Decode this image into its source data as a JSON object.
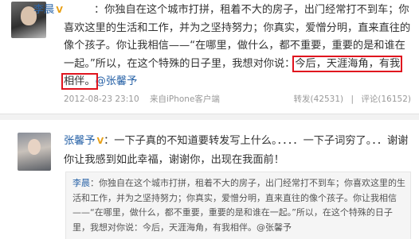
{
  "post1": {
    "author": "李晨",
    "verified_badge": "V",
    "before_highlight1": "：你独自在这个城市打拼，租着不大的房子，出门经常打不到车；你喜欢这里的生活和工作，并为之坚持努力；你真实，爱憎分明，直来直往的像个孩子。你让我相信——“在哪里，做什么，都不重要，重要的是和谁在一起。”所以，在这个特殊的日子里，我想对你说：",
    "highlight1": "今后，天涯海角，有我",
    "highlight2": "相伴。",
    "mention": "@张馨予",
    "timestamp": "2012-08-23 23:10",
    "source": "来自iPhone客户端",
    "repost": "转发(42531)",
    "comment": "评论(16152)",
    "sep": "|"
  },
  "post2": {
    "author": "张馨予",
    "verified_badge": "V",
    "body": "：一下子真的不知道要转发写上什么。．．．．一下子词穷了。．．谢谢你让我感到如此幸福，谢谢你，出现在我面前！",
    "quote_author": "李晨",
    "quote_text": "：你独自在这个城市打拼，租着不大的房子，出门经常打不到车；你喜欢这里的生活和工作，并为之坚持努力；你真实，爱憎分明，直来直往的像个孩子。你让我相信——“在哪里，做什么，都不重要，重要的是和谁在一起。”所以，在这个特殊的日子里，我想对你说：今后，天涯海角，有我相伴。@张馨予"
  }
}
